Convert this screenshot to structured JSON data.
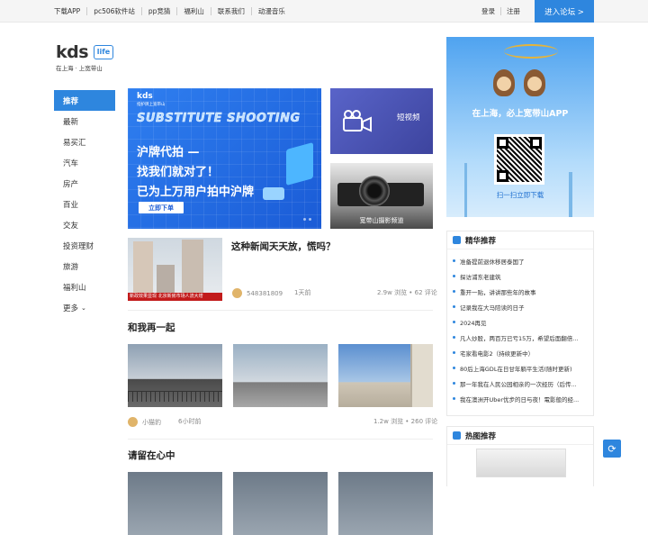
{
  "topbar": {
    "links": [
      "下载APP",
      "pc506软件站",
      "pp竞猜",
      "福利山",
      "联系我们",
      "动漫音乐"
    ],
    "login": "登录",
    "register": "注册",
    "enter": "进入论坛 >"
  },
  "logo": {
    "name": "kds",
    "badge": "life",
    "tagline": "在上海 · 上宽带山"
  },
  "sidenav": [
    "推荐",
    "最新",
    "易买汇",
    "汽车",
    "房产",
    "百业",
    "交友",
    "投资理财",
    "旅游",
    "福利山",
    "更多"
  ],
  "banner": {
    "brand": "kds",
    "brand_sub": "指护牌上宽带山",
    "english": "SUBSTITUTE SHOOTING",
    "line1": "沪牌代拍 —",
    "line2": "找我们就对了！",
    "line3": "已为上万用户拍中沪牌",
    "button": "立即下单"
  },
  "tiles": {
    "video": "短视频",
    "photo": "宽带山摄影频道"
  },
  "article1": {
    "title": "这种新闻天天放，慌吗？",
    "caption": "新政效果显现 北京新房市场人流大增",
    "author": "548381809",
    "time": "1天前",
    "stats": "2.9w 浏览 • 62 评论"
  },
  "section2": {
    "title": "和我再一起",
    "author": "小猫豹",
    "time": "6小时前",
    "stats": "1.2w 浏览 • 260 评论"
  },
  "section3": {
    "title": "请留在心中"
  },
  "ad": {
    "slogan": "在上海，必上宽带山APP",
    "scan": "扫一扫立即下载"
  },
  "featured": {
    "title": "精华推荐",
    "items": [
      "准备提前退休移居泰国了",
      "探访浦东老建筑",
      "重开一贴，讲讲那些年的故事",
      "记录我在大马陪读的日子",
      "2024再见",
      "凡人炒股，两百万已亏15万，希望后面翻倍...",
      "宅家看电影2（持续更新中）",
      "80后上海GDL在日甘年躺平生活(随时更新)",
      "那一年我在人民公园相亲的一次经历（后传...",
      "我在澳洲开Uber优步的日与夜！電影般的经..."
    ]
  },
  "hot": {
    "title": "热图推荐"
  }
}
